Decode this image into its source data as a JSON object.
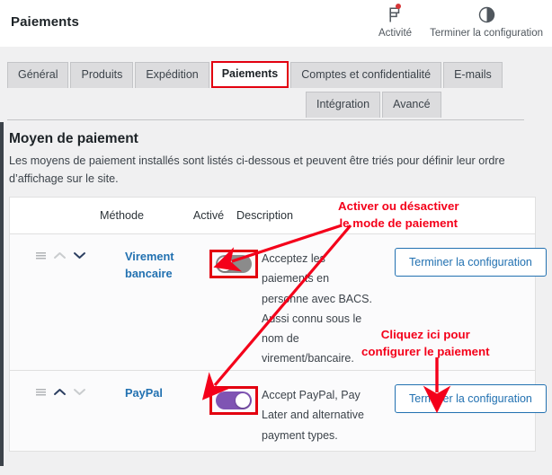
{
  "header": {
    "title": "Paiements",
    "actions": [
      {
        "label": "Activité",
        "icon": "flag-icon",
        "badge": true
      },
      {
        "label": "Terminer la configuration",
        "icon": "progress-circle-icon",
        "badge": false
      }
    ]
  },
  "tabs": {
    "row1": [
      {
        "label": "Général",
        "active": false
      },
      {
        "label": "Produits",
        "active": false
      },
      {
        "label": "Expédition",
        "active": false
      },
      {
        "label": "Paiements",
        "active": true
      },
      {
        "label": "Comptes et confidentialité",
        "active": false
      },
      {
        "label": "E-mails",
        "active": false
      }
    ],
    "row2": [
      {
        "label": "Intégration",
        "active": false
      },
      {
        "label": "Avancé",
        "active": false
      }
    ]
  },
  "page": {
    "heading": "Moyen de paiement",
    "description": "Les moyens de paiement installés sont listés ci-dessous et peuvent être triés pour définir leur ordre d’affichage sur le site."
  },
  "table": {
    "columns": {
      "method": "Méthode",
      "enabled": "Activé",
      "description": "Description"
    },
    "rows": [
      {
        "name": "Virement bancaire",
        "enabled": false,
        "toggle_state": "off",
        "description": "Acceptez les paiements en personne avec BACS. Aussi connu sous le nom de virement/bancaire.",
        "action_label": "Terminer la configuration",
        "sort_up_active": false,
        "sort_down_active": true
      },
      {
        "name": "PayPal",
        "enabled": true,
        "toggle_state": "on",
        "description": "Accept PayPal, Pay Later and alternative payment types.",
        "action_label": "Terminer la configuration",
        "sort_up_active": true,
        "sort_down_active": false
      }
    ]
  },
  "annotations": [
    {
      "line1": "Activer ou désactiver",
      "line2": "le mode de paiement"
    },
    {
      "line1": "Cliquez ici pour",
      "line2": "configurer le paiement"
    }
  ],
  "colors": {
    "annotation_red": "#f4001a",
    "highlight_red": "#e3000f",
    "link_blue": "#2271b1",
    "toggle_on_purple": "#7f54b3",
    "toggle_off_gray": "#8b8b8b"
  }
}
